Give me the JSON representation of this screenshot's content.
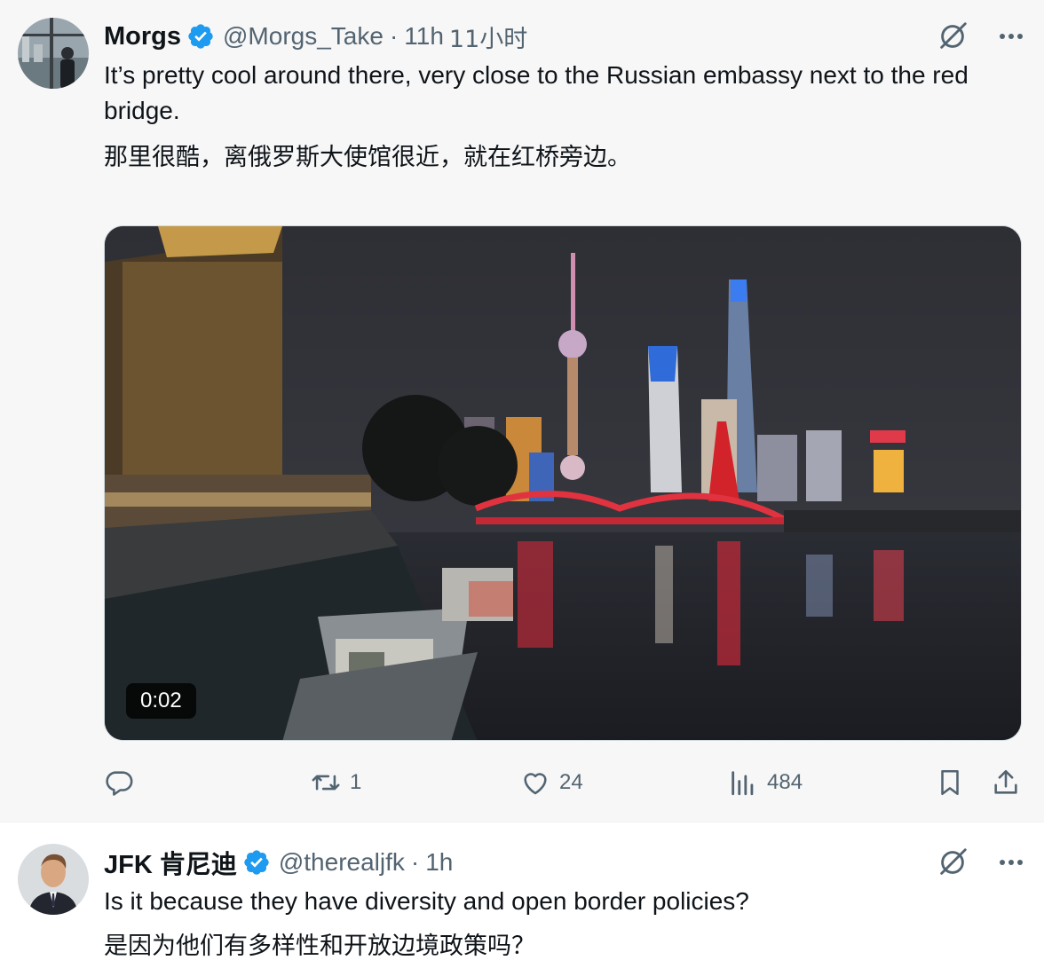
{
  "tweets": [
    {
      "author_name": "Morgs",
      "handle": "@Morgs_Take",
      "separator": "·",
      "time": "11h",
      "time_translated": "11小时",
      "text_en": "It’s pretty cool around there, very close to the Russian embassy next to the red bridge.",
      "text_cn": "那里很酷，离俄罗斯大使馆很近，就在红桥旁边。",
      "media": {
        "type": "video",
        "duration": "0:02"
      },
      "actions": {
        "reply_count": "",
        "retweet_count": "1",
        "like_count": "24",
        "view_count": "484"
      }
    },
    {
      "author_name": "JFK 肯尼迪",
      "handle": "@therealjfk",
      "separator": "·",
      "time": "1h",
      "text_en": "Is it because they have diversity and open border policies?",
      "text_cn": "是因为他们有多样性和开放边境政策吗？"
    }
  ],
  "icons": [
    "verified-badge-icon",
    "grok-translate-icon",
    "more-icon",
    "reply-icon",
    "retweet-icon",
    "like-icon",
    "views-icon",
    "bookmark-icon",
    "share-icon"
  ],
  "colors": {
    "verified": "#1d9bf0",
    "muted": "#536471",
    "text": "#0f1419"
  }
}
